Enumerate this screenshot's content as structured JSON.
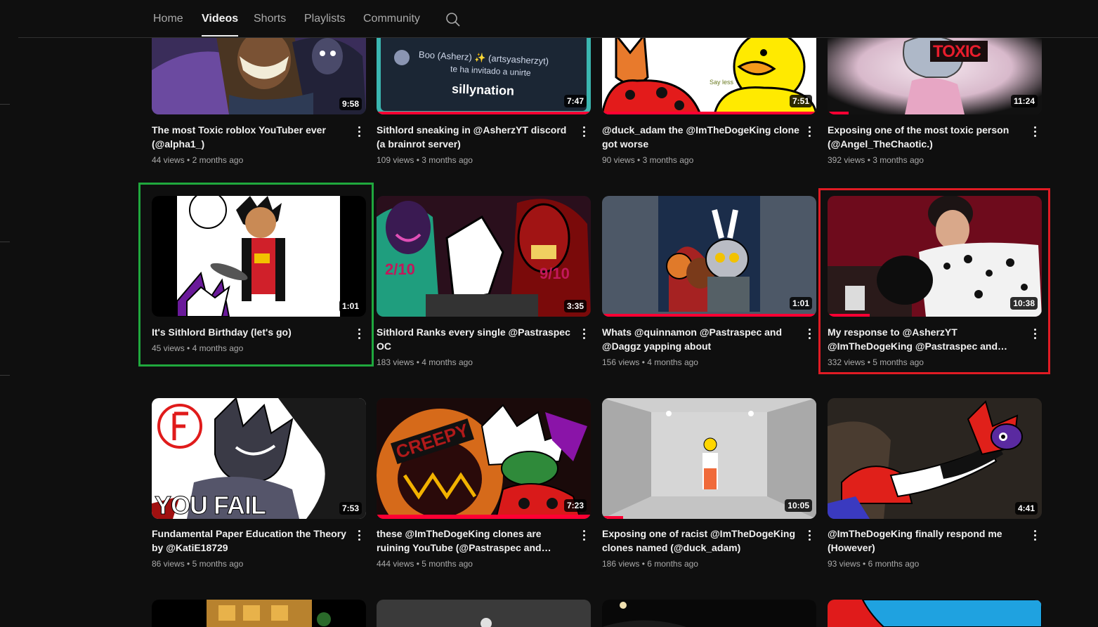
{
  "tabs": [
    {
      "label": "Home"
    },
    {
      "label": "Videos",
      "active": true
    },
    {
      "label": "Shorts"
    },
    {
      "label": "Playlists"
    },
    {
      "label": "Community"
    }
  ],
  "search_icon": "search-icon",
  "videos": [
    {
      "title": "The most Toxic roblox YouTuber ever (@alpha1_)",
      "views": "44 views",
      "age": "2 months ago",
      "duration": "9:58"
    },
    {
      "title": "Sithlord sneaking in @AsherzYT discord (a brainrot server)",
      "views": "109 views",
      "age": "3 months ago",
      "duration": "7:47",
      "thumb_text": {
        "user": "Boo (Asherz) ✨ (artsyasherzyt)",
        "invite": "te ha invitado a unirte",
        "server": "sillynation"
      }
    },
    {
      "title": "@duck_adam the @ImTheDogeKing clone got worse",
      "views": "90 views",
      "age": "3 months ago",
      "duration": "7:51",
      "thumb_text": {
        "caption": "Say less"
      }
    },
    {
      "title": "Exposing one of the most toxic person (@Angel_TheChaotic.)",
      "views": "392 views",
      "age": "3 months ago",
      "duration": "11:24",
      "thumb_text": {
        "caption": "TOXIC"
      }
    },
    {
      "title": "It's Sithlord Birthday (let's go)",
      "views": "45 views",
      "age": "4 months ago",
      "duration": "1:01"
    },
    {
      "title": "Sithlord Ranks every single @Pastraspec OC",
      "views": "183 views",
      "age": "4 months ago",
      "duration": "3:35",
      "thumb_text": {
        "left": "2/10",
        "right": "9/10"
      }
    },
    {
      "title": "Whats @quinnamon @Pastraspec and @Daggz yapping about",
      "views": "156 views",
      "age": "4 months ago",
      "duration": "1:01"
    },
    {
      "title": "My response to @AsherzYT @ImTheDogeKing @Pastraspec and…",
      "views": "332 views",
      "age": "5 months ago",
      "duration": "10:38"
    },
    {
      "title": "Fundamental Paper Education the Theory by @KatiE18729",
      "views": "86 views",
      "age": "5 months ago",
      "duration": "7:53",
      "thumb_text": {
        "caption": "YOU FAIL"
      }
    },
    {
      "title": "these @ImTheDogeKing clones are ruining YouTube (@Pastraspec and @Phisnom)",
      "views": "444 views",
      "age": "5 months ago",
      "duration": "7:23",
      "thumb_text": {
        "caption": "CREEPY"
      }
    },
    {
      "title": "Exposing one of racist @ImTheDogeKing clones named (@duck_adam)",
      "views": "186 views",
      "age": "6 months ago",
      "duration": "10:05"
    },
    {
      "title": "@ImTheDogeKing finally respond me (However)",
      "views": "93 views",
      "age": "6 months ago",
      "duration": "4:41"
    }
  ],
  "highlights": {
    "green": "#1fa83d",
    "red": "#e01b24"
  },
  "colors": {
    "background": "#0f0f0f",
    "progress": "#ff0033",
    "text": "#f1f1f1",
    "secondary": "#aaaaaa"
  }
}
